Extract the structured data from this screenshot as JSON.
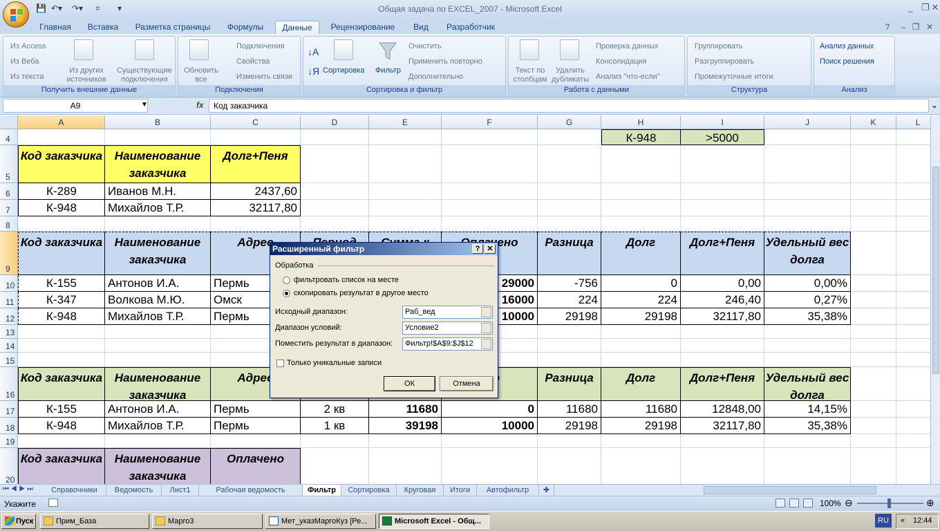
{
  "window": {
    "title": "Общая задача по EXCEL_2007 - Microsoft Excel"
  },
  "tabs": [
    "Главная",
    "Вставка",
    "Разметка страницы",
    "Формулы",
    "Данные",
    "Рецензирование",
    "Вид",
    "Разработчик"
  ],
  "active_tab": "Данные",
  "ribbon": {
    "groups": {
      "external": {
        "label": "Получить внешние данные",
        "access": "Из Access",
        "web": "Из Веба",
        "text": "Из текста",
        "other": "Из других источников",
        "existing": "Существующие подключения"
      },
      "connections": {
        "label": "Подключения",
        "refresh": "Обновить все",
        "connections": "Подключения",
        "properties": "Свойства",
        "edit_links": "Изменить связи"
      },
      "sort_filter": {
        "label": "Сортировка и фильтр",
        "sort": "Сортировка",
        "filter": "Фильтр",
        "clear": "Очистить",
        "reapply": "Применить повторно",
        "advanced": "Дополнительно"
      },
      "data_tools": {
        "label": "Работа с данными",
        "text_to_cols": "Текст по столбцам",
        "remove_dup": "Удалить дубликаты",
        "validation": "Проверка данных",
        "consolidate": "Консолидация",
        "whatif": "Анализ \"что-если\""
      },
      "outline": {
        "label": "Структура",
        "group": "Группировать",
        "ungroup": "Разгруппировать",
        "subtotal": "Промежуточные итоги"
      },
      "analysis": {
        "label": "Анализ",
        "data_analysis": "Анализ данных",
        "solver": "Поиск решения"
      }
    }
  },
  "formula_bar": {
    "name_box": "A9",
    "fx": "fx",
    "content": "Код заказчика"
  },
  "columns": [
    "A",
    "B",
    "C",
    "D",
    "E",
    "F",
    "G",
    "H",
    "I",
    "J",
    "K",
    "L"
  ],
  "rows": [
    "4",
    "5",
    "6",
    "7",
    "8",
    "9",
    "10",
    "11",
    "12",
    "13",
    "14",
    "15",
    "16",
    "17",
    "18",
    "19",
    "20"
  ],
  "cells": {
    "h4": "К-948",
    "i4": ">5000",
    "crit_hdr": [
      "Код заказчика",
      "Наименование заказчика",
      "Долг+Пеня"
    ],
    "crit_rows": [
      [
        "К-289",
        "Иванов М.Н.",
        "2437,60"
      ],
      [
        "К-948",
        "Михайлов Т.Р.",
        "32117,80"
      ]
    ],
    "main_hdr": [
      "Код заказчика",
      "Наименование заказчика",
      "Адрес",
      "Период",
      "Сумма к",
      "Оплачено",
      "Разница",
      "Долг",
      "Долг+Пеня",
      "Удельный вес долга"
    ],
    "main_rows": [
      [
        "К-155",
        "Антонов И.А.",
        "Пермь",
        "",
        "",
        "29000",
        "-756",
        "0",
        "0,00",
        "0,00%"
      ],
      [
        "К-347",
        "Волкова М.Ю.",
        "Омск",
        "",
        "",
        "16000",
        "224",
        "224",
        "246,40",
        "0,27%"
      ],
      [
        "К-948",
        "Михайлов Т.Р.",
        "Пермь",
        "",
        "",
        "10000",
        "29198",
        "29198",
        "32117,80",
        "35,38%"
      ]
    ],
    "res_hdr": [
      "Код заказчика",
      "Наименование заказчика",
      "Адрес",
      "",
      "",
      "ено",
      "Разница",
      "Долг",
      "Долг+Пеня",
      "Удельный вес долга"
    ],
    "res_rows": [
      [
        "К-155",
        "Антонов И.А.",
        "Пермь",
        "2 кв",
        "11680",
        "0",
        "11680",
        "11680",
        "12848,00",
        "14,15%"
      ],
      [
        "К-948",
        "Михайлов Т.Р.",
        "Пермь",
        "1 кв",
        "39198",
        "10000",
        "29198",
        "29198",
        "32117,80",
        "35,38%"
      ]
    ],
    "bot_hdr": [
      "Код заказчика",
      "Наименование заказчика",
      "Оплачено"
    ]
  },
  "dialog": {
    "title": "Расширенный фильтр",
    "help": "?",
    "close": "✕",
    "section": "Обработка",
    "opt1": "фильтровать список на месте",
    "opt2": "скопировать результат в другое место",
    "src_label": "Исходный диапазон:",
    "src_value": "Раб_вед",
    "cond_label": "Диапазон условий:",
    "cond_value": "Условие2",
    "dest_label": "Поместить результат в диапазон:",
    "dest_value": "Фильтр!$A$9:$J$12",
    "unique": "Только уникальные записи",
    "ok": "ОК",
    "cancel": "Отмена"
  },
  "sheet_tabs": [
    "Справочники",
    "Ведомость",
    "Лист1",
    "Рабочая ведомость",
    "Фильтр",
    "Сортировка",
    "Круговая",
    "Итоги",
    "Автофильтр"
  ],
  "active_sheet": "Фильтр",
  "status": {
    "mode": "Укажите",
    "zoom": "100%"
  },
  "taskbar": {
    "start": "Пуск",
    "items": [
      "Прим_База",
      "Марго3",
      "Мет_указМаргоКуз [Ре...",
      "Microsoft Excel - Общ..."
    ],
    "lang": "RU",
    "clock": "12:44"
  }
}
